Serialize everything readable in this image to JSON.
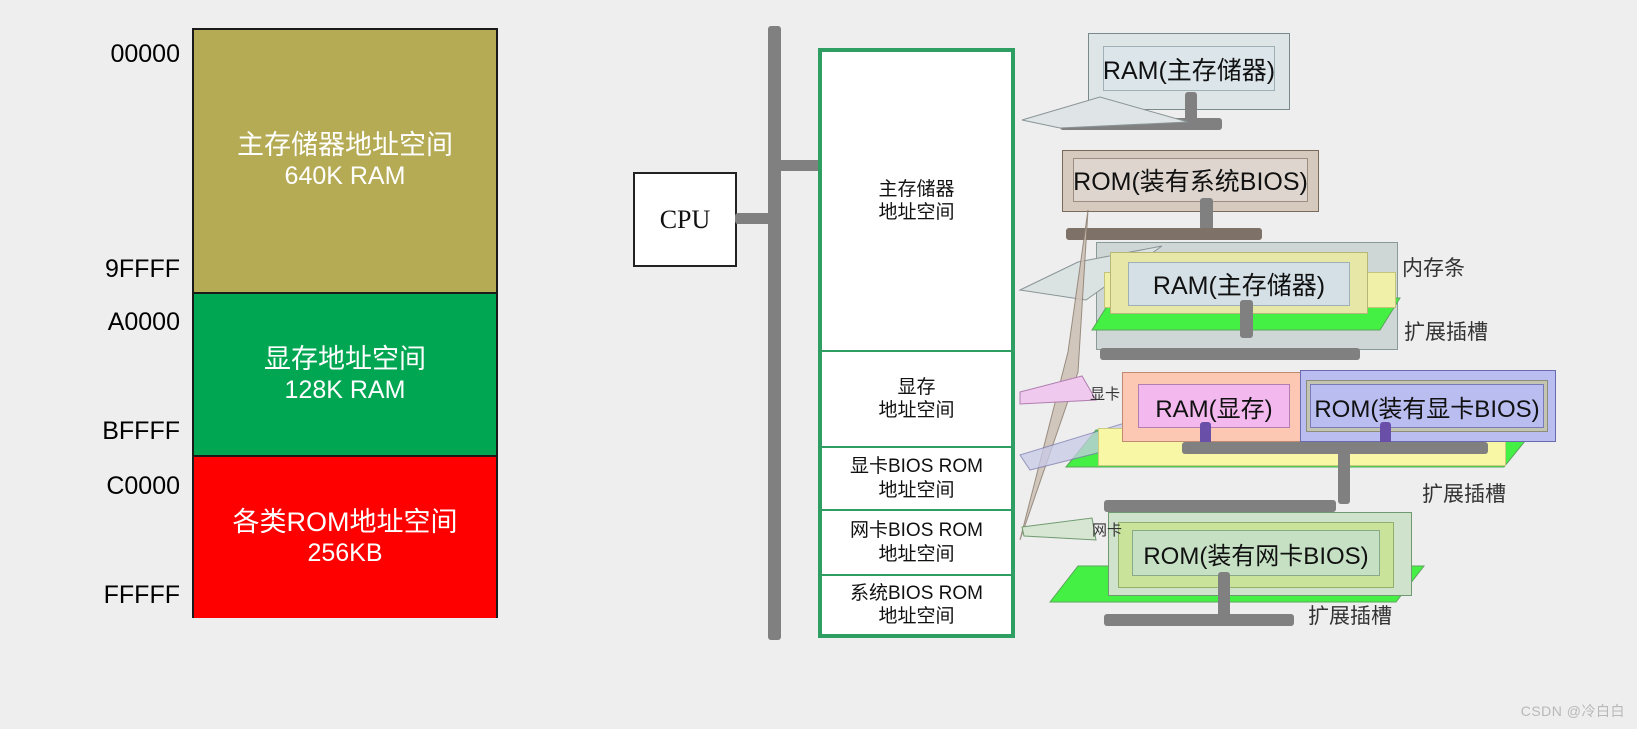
{
  "memory_map": {
    "title": "memory address map",
    "blocks": [
      {
        "name": "main-memory",
        "label": "主存储器地址空间",
        "sublabel": "640K RAM",
        "color": "#b5ab54",
        "text_color": "#ffffff",
        "start": "00000",
        "end": "9FFFF"
      },
      {
        "name": "video-memory",
        "label": "显存地址空间",
        "sublabel": "128K RAM",
        "color": "#00a651",
        "text_color": "#ffffff",
        "start": "A0000",
        "end": "BFFFF"
      },
      {
        "name": "rom-space",
        "label": "各类ROM地址空间",
        "sublabel": "256KB",
        "color": "#fe0000",
        "text_color": "#ffffff",
        "start": "C0000",
        "end": "FFFFF"
      }
    ],
    "addresses": [
      "00000",
      "9FFFF",
      "A0000",
      "BFFFF",
      "C0000",
      "FFFFF"
    ]
  },
  "cpu": {
    "label": "CPU"
  },
  "address_column": {
    "rows": [
      {
        "name": "main-memory-space",
        "line1": "主存储器",
        "line2": "地址空间"
      },
      {
        "name": "video-memory-space",
        "line1": "显存",
        "line2": "地址空间"
      },
      {
        "name": "vga-bios-rom-space",
        "line1": "显卡BIOS ROM",
        "line2": "地址空间"
      },
      {
        "name": "nic-bios-rom-space",
        "line1": "网卡BIOS ROM",
        "line2": "地址空间"
      },
      {
        "name": "system-bios-rom-space",
        "line1": "系统BIOS ROM",
        "line2": "地址空间"
      }
    ]
  },
  "devices": [
    {
      "name": "ram-main-memory-top",
      "label": "RAM(主存储器)",
      "fill": "#dde5e6",
      "inner_fill": "#dce6ea",
      "border": "#7a8a8a"
    },
    {
      "name": "rom-system-bios",
      "label": "ROM(装有系统BIOS)",
      "fill": "#d6c9bd",
      "inner_fill": "#ded6ce",
      "border": "#7a6a5a"
    },
    {
      "name": "ram-main-memory-module",
      "label": "RAM(主存储器)",
      "fill": "#d5dedd",
      "inner_fill": "#d4e0e6",
      "border": "#8a9a96"
    },
    {
      "name": "ram-video-memory",
      "label": "RAM(显存)",
      "fill": "#fcc8b4",
      "inner_fill": "#f3b8ee",
      "border": "#b07fb0"
    },
    {
      "name": "rom-vga-bios",
      "label": "ROM(装有显卡BIOS)",
      "fill": "#c4c4b2",
      "inner_fill": "#b9bdf0",
      "border": "#6a6ab0"
    },
    {
      "name": "rom-nic-bios",
      "label": "ROM(装有网卡BIOS)",
      "fill": "#cfe2cb",
      "inner_fill": "#c9e49a",
      "border": "#6f9a6f"
    }
  ],
  "annotations": [
    {
      "name": "memory-module-label",
      "text": "内存条"
    },
    {
      "name": "expansion-slot-label-1",
      "text": "扩展插槽"
    },
    {
      "name": "expansion-slot-label-2",
      "text": "扩展插槽"
    },
    {
      "name": "expansion-slot-label-3",
      "text": "扩展插槽"
    },
    {
      "name": "graphics-card-label",
      "text": "显卡"
    },
    {
      "name": "network-card-label",
      "text": "网卡"
    }
  ],
  "watermark": {
    "text": "CSDN @冷白白"
  },
  "colors": {
    "background": "#eeeeee",
    "bus": "#808080",
    "column_border": "#2e9e63",
    "slot_green": "#45f045",
    "slot_yellow": "#f5f5a0"
  }
}
